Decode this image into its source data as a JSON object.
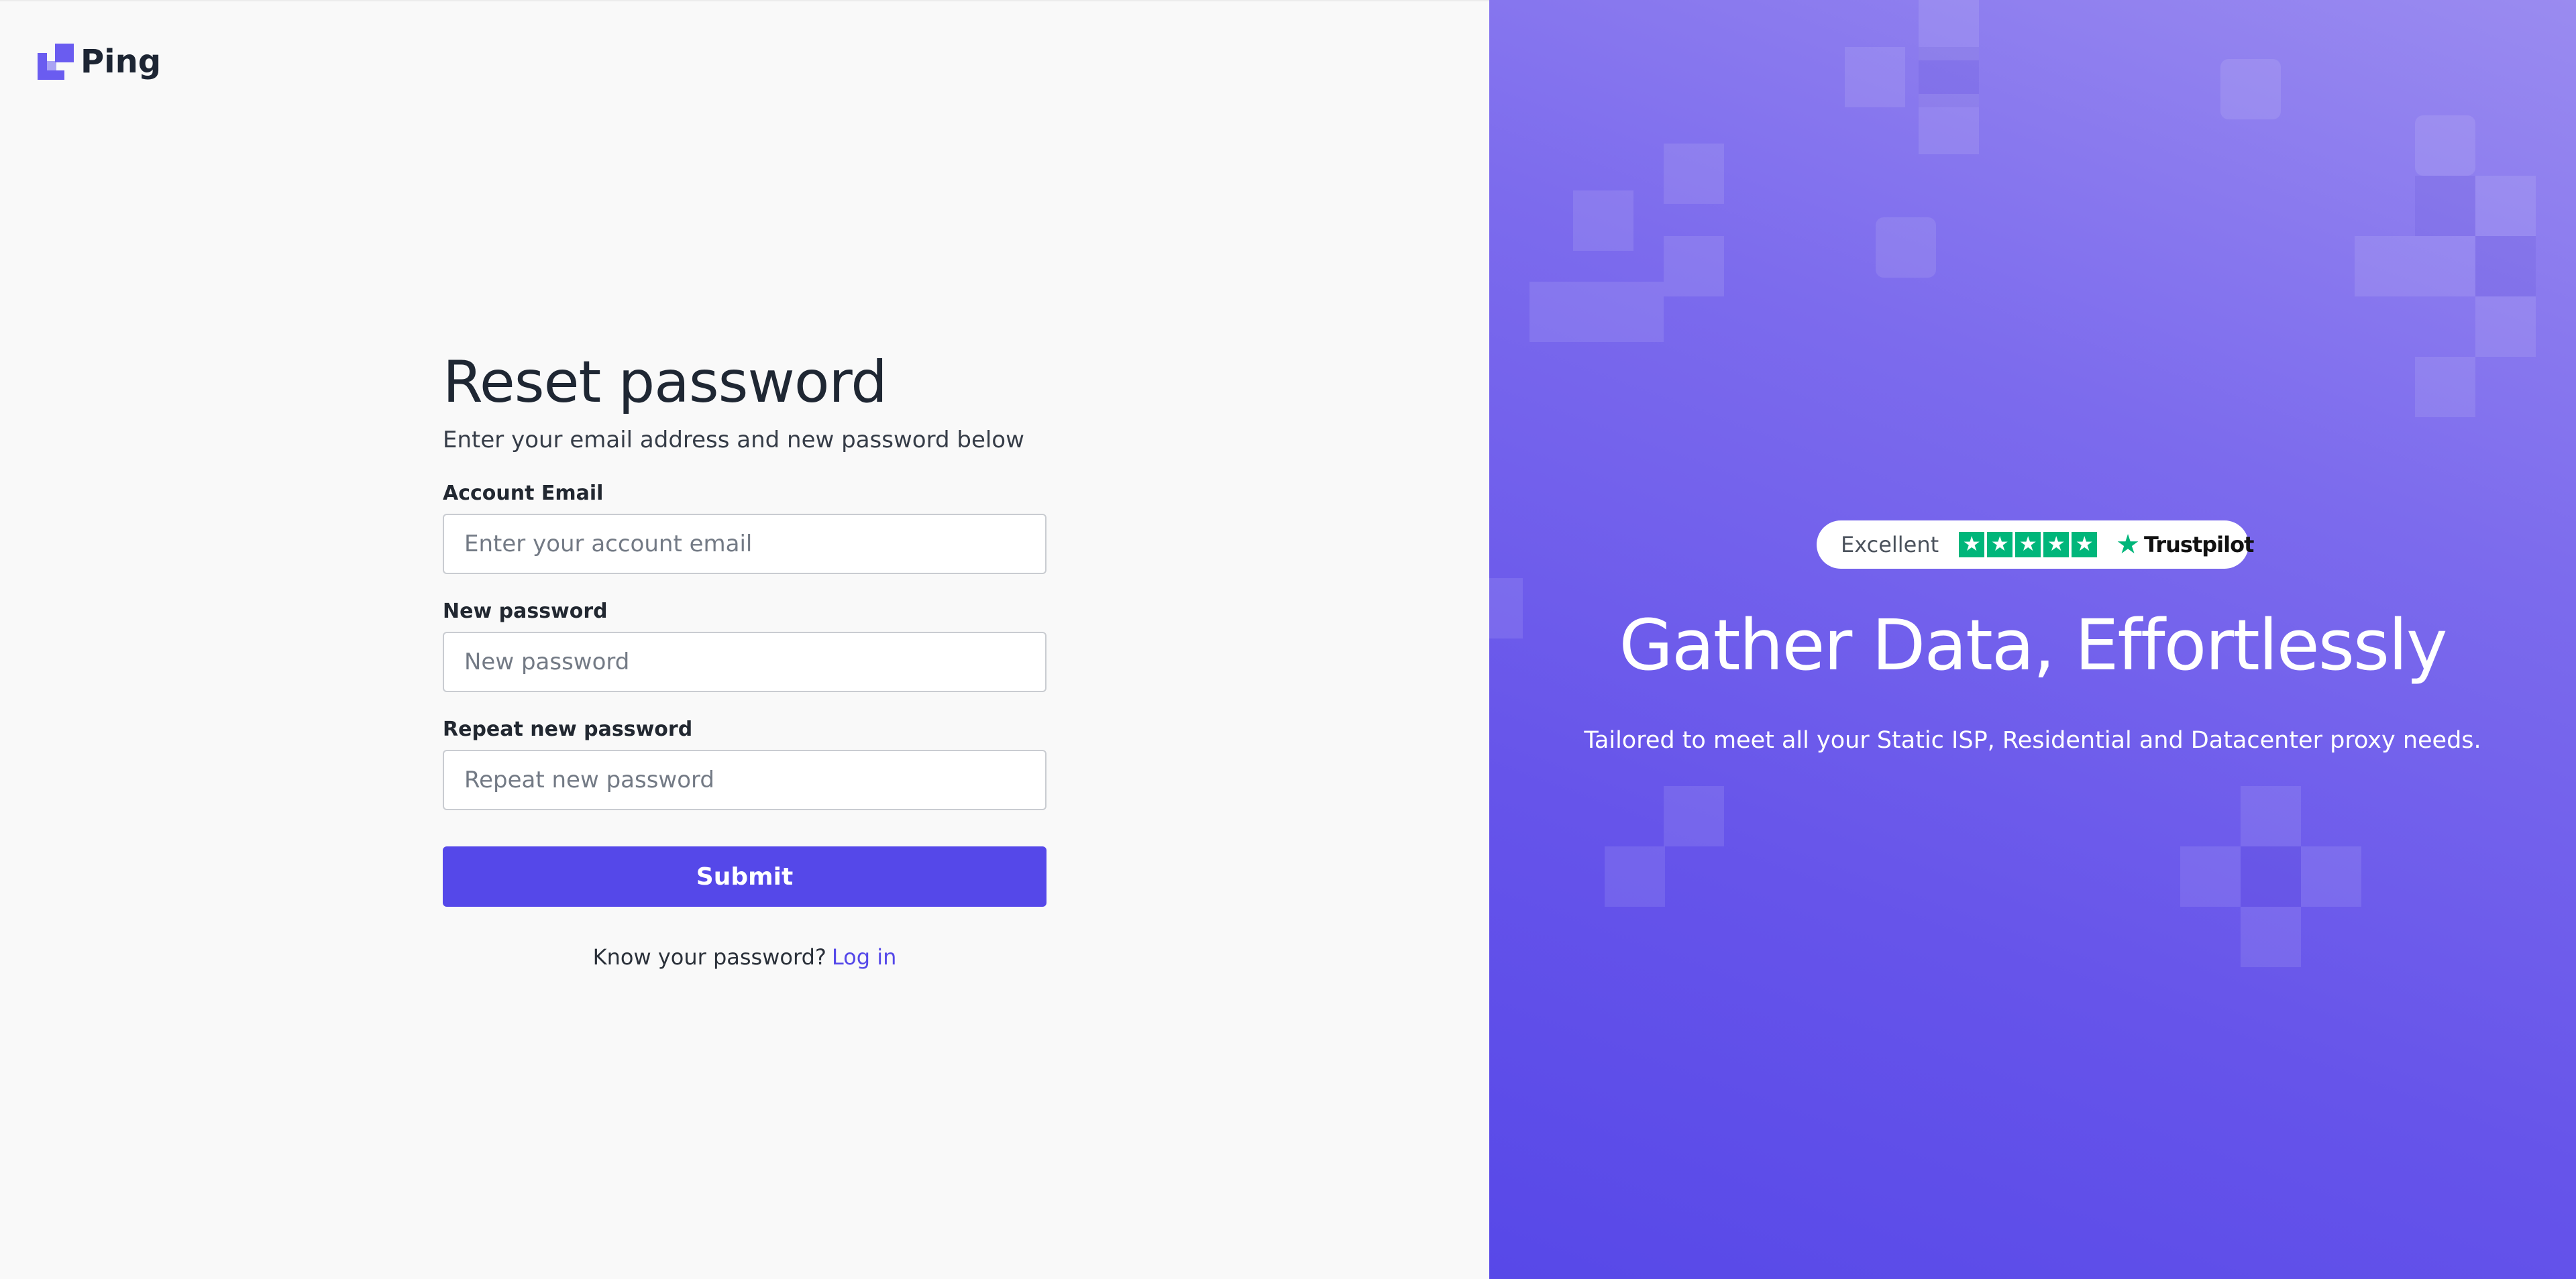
{
  "brand": {
    "name": "Ping",
    "logo_icon": "ping-logo-icon",
    "accent_color": "#5548e9"
  },
  "form": {
    "title": "Reset password",
    "subtitle": "Enter your email address and new password below",
    "email": {
      "label": "Account Email",
      "placeholder": "Enter your account email",
      "value": ""
    },
    "new_password": {
      "label": "New password",
      "placeholder": "New password",
      "value": ""
    },
    "repeat_password": {
      "label": "Repeat new password",
      "placeholder": "Repeat new password",
      "value": ""
    },
    "submit_label": "Submit",
    "login_prompt": "Know your password?",
    "login_link": "Log in"
  },
  "promo": {
    "rating_label": "Excellent",
    "rating_stars": 5,
    "star_icon": "star-icon",
    "trustpilot_name": "Trustpilot",
    "trustpilot_color": "#00b67a",
    "headline": "Gather Data, Effortlessly",
    "tagline": "Tailored to meet all your Static ISP, Residential and Datacenter proxy needs."
  }
}
